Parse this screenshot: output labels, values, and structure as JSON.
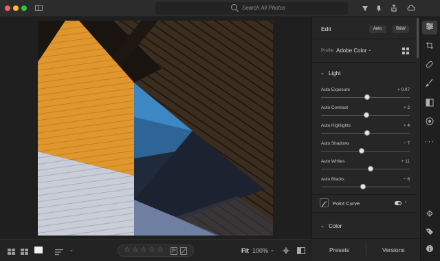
{
  "window": {
    "traffic_lights": [
      "#fe5f57",
      "#febc2e",
      "#28c840"
    ]
  },
  "search": {
    "placeholder": "Search All Photos"
  },
  "toolbar_icons": [
    "filter-icon",
    "bell-icon",
    "share-icon",
    "cloud-icon"
  ],
  "edit_panel": {
    "title": "Edit",
    "auto_label": "Auto",
    "bw_label": "B&W",
    "profile_label": "Profile",
    "profile_value": "Adobe Color",
    "light_section": "Light",
    "sliders": [
      {
        "label": "Auto Exposure",
        "value": "+ 0.07",
        "position": 0.52
      },
      {
        "label": "Auto Contrast",
        "value": "+ 2",
        "position": 0.51
      },
      {
        "label": "Auto Highlights",
        "value": "+ 4",
        "position": 0.52
      },
      {
        "label": "Auto Shadows",
        "value": "− 7",
        "position": 0.46
      },
      {
        "label": "Auto Whites",
        "value": "+ 11",
        "position": 0.56
      },
      {
        "label": "Auto Blacks",
        "value": "− 6",
        "position": 0.47
      }
    ],
    "point_curve_label": "Point Curve",
    "color_section": "Color"
  },
  "footer": {
    "presets_label": "Presets",
    "versions_label": "Versions"
  },
  "bottom_bar": {
    "rating_stars": 5,
    "fit_label": "Fit",
    "zoom_label": "100%"
  },
  "colors": {
    "accent": "#ffffff",
    "photo_orange": "#e0972e",
    "photo_blue": "#3d87c5"
  }
}
